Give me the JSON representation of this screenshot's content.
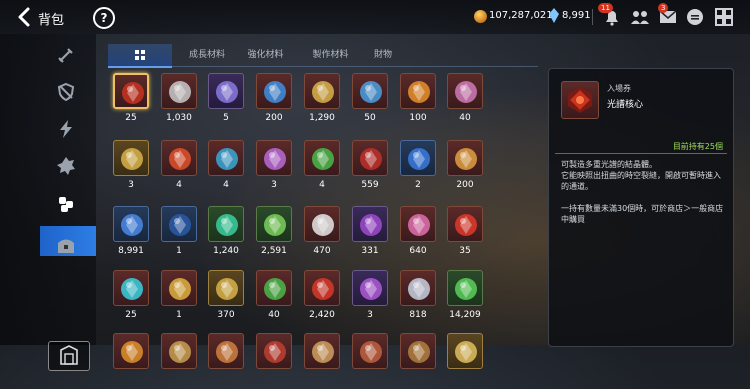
{
  "header": {
    "title": "背包",
    "help_label": "?",
    "gold": "107,287,021",
    "gems": "8,991",
    "mail_badge": "11",
    "msg_badge": "3"
  },
  "tabs": [
    {
      "label": "",
      "icon": "grid-icon",
      "selected": true
    },
    {
      "label": "成長材料"
    },
    {
      "label": "強化材料"
    },
    {
      "label": "製作材料"
    },
    {
      "label": "財物"
    }
  ],
  "nav": [
    {
      "icon": "sword-icon"
    },
    {
      "icon": "shield-icon"
    },
    {
      "icon": "lightning-icon"
    },
    {
      "icon": "emblem-icon"
    },
    {
      "icon": "materials-icon",
      "selected": true
    },
    {
      "icon": "chest-icon"
    }
  ],
  "items": [
    {
      "qty": "25",
      "icon": "red-core-icon",
      "color": "#c8341e",
      "bg": "",
      "selected": true
    },
    {
      "qty": "1,030",
      "icon": "silver-medal-icon",
      "color": "#c9c9c9",
      "bg": ""
    },
    {
      "qty": "5",
      "icon": "crystal-cluster-icon",
      "color": "#8a7ae0",
      "bg": "purple"
    },
    {
      "qty": "200",
      "icon": "blue-orb-icon",
      "color": "#3f8fe0",
      "bg": ""
    },
    {
      "qty": "1,290",
      "icon": "eye-emblem-icon",
      "color": "#d9b34a",
      "bg": ""
    },
    {
      "qty": "50",
      "icon": "blue-eye-emblem-icon",
      "color": "#4aa0e0",
      "bg": ""
    },
    {
      "qty": "100",
      "icon": "flame-shard-icon",
      "color": "#e8902a",
      "bg": ""
    },
    {
      "qty": "40",
      "icon": "pink-orb-icon",
      "color": "#d07ab8",
      "bg": ""
    },
    {
      "qty": "3",
      "icon": "ticket-icon",
      "color": "#d9b34a",
      "bg": "gold"
    },
    {
      "qty": "4",
      "icon": "fire-petal-icon",
      "color": "#e0502a",
      "bg": ""
    },
    {
      "qty": "4",
      "icon": "blue-amulet-icon",
      "color": "#3aa8d8",
      "bg": ""
    },
    {
      "qty": "3",
      "icon": "rune-ring-icon",
      "color": "#b86ad8",
      "bg": ""
    },
    {
      "qty": "4",
      "icon": "green-tree-icon",
      "color": "#4ab84a",
      "bg": ""
    },
    {
      "qty": "559",
      "icon": "red-cookie-icon",
      "color": "#c0302a",
      "bg": ""
    },
    {
      "qty": "2",
      "icon": "blue-ticket-icon",
      "color": "#3a7ae0",
      "bg": "blue"
    },
    {
      "qty": "200",
      "icon": "golden-bouquet-icon",
      "color": "#e0a040",
      "bg": ""
    },
    {
      "qty": "8,991",
      "icon": "blue-gem-icon",
      "color": "#4a8ae8",
      "bg": "blue"
    },
    {
      "qty": "1",
      "icon": "dark-flower-icon",
      "color": "#2a5aa8",
      "bg": "blue"
    },
    {
      "qty": "1,240",
      "icon": "green-cube-icon",
      "color": "#3ad0a0",
      "bg": "green"
    },
    {
      "qty": "2,591",
      "icon": "green-leaf-icon",
      "color": "#7ad05a",
      "bg": "green"
    },
    {
      "qty": "470",
      "icon": "white-star-icon",
      "color": "#e6e6e6",
      "bg": ""
    },
    {
      "qty": "331",
      "icon": "purple-card-icon",
      "color": "#a04ad0",
      "bg": "purple"
    },
    {
      "qty": "640",
      "icon": "pink-crystals-icon",
      "color": "#e070b0",
      "bg": ""
    },
    {
      "qty": "35",
      "icon": "red-petal-icon",
      "color": "#e03a2a",
      "bg": ""
    },
    {
      "qty": "25",
      "icon": "cyan-amulet-icon",
      "color": "#3ad0e0",
      "bg": ""
    },
    {
      "qty": "1",
      "icon": "gold-star-icon",
      "color": "#e0b040",
      "bg": ""
    },
    {
      "qty": "370",
      "icon": "gold-card-icon",
      "color": "#d9b34a",
      "bg": "gold"
    },
    {
      "qty": "40",
      "icon": "green-sapling-icon",
      "color": "#4ab84a",
      "bg": ""
    },
    {
      "qty": "2,420",
      "icon": "red-ring-icon",
      "color": "#d83a2a",
      "bg": ""
    },
    {
      "qty": "3",
      "icon": "purple-rune-icon",
      "color": "#b05ad8",
      "bg": "purple"
    },
    {
      "qty": "818",
      "icon": "silver-shard-icon",
      "color": "#c8d0e0",
      "bg": ""
    },
    {
      "qty": "14,209",
      "icon": "green-heart-icon",
      "color": "#5ad05a",
      "bg": "green"
    },
    {
      "qty": "",
      "icon": "item-icon",
      "color": "#e0902a",
      "bg": ""
    },
    {
      "qty": "",
      "icon": "item-icon",
      "color": "#c8a050",
      "bg": ""
    },
    {
      "qty": "",
      "icon": "item-icon",
      "color": "#d08040",
      "bg": ""
    },
    {
      "qty": "",
      "icon": "item-icon",
      "color": "#c04030",
      "bg": ""
    },
    {
      "qty": "",
      "icon": "item-icon",
      "color": "#d0a060",
      "bg": ""
    },
    {
      "qty": "",
      "icon": "item-icon",
      "color": "#c06040",
      "bg": ""
    },
    {
      "qty": "",
      "icon": "item-icon",
      "color": "#b08040",
      "bg": ""
    },
    {
      "qty": "",
      "icon": "item-icon",
      "color": "#e0c060",
      "bg": "gold"
    }
  ],
  "detail": {
    "category": "入場券",
    "name": "光譜核心",
    "held": "目前持有25個",
    "description": "可製造多重光譜的結晶體。\n它能映照出扭曲的時空裂縫，開啟可暫時進入的通道。\n\n一持有數量未滿30個時，可於商店＞一般商店中購買"
  }
}
